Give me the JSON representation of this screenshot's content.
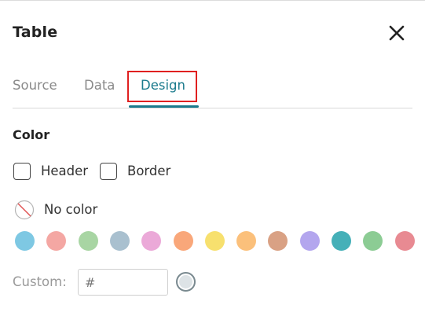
{
  "dialog": {
    "title": "Table"
  },
  "tabs": [
    {
      "label": "Source"
    },
    {
      "label": "Data"
    },
    {
      "label": "Design",
      "active": true
    }
  ],
  "color_section": {
    "title": "Color",
    "header_label": "Header",
    "border_label": "Border",
    "header_checked": false,
    "border_checked": false,
    "no_color_label": "No color"
  },
  "swatches": [
    "#7ec8e3",
    "#f4a7a3",
    "#a8d5a3",
    "#a9c0cf",
    "#eba9d8",
    "#f9a77a",
    "#f7e06e",
    "#fbc07b",
    "#d9a184",
    "#b3a6ee",
    "#45b0b8",
    "#8ccc94",
    "#e88a92"
  ],
  "custom": {
    "label": "Custom:",
    "placeholder": "#",
    "swatch_color": "#dde3e6"
  },
  "colors": {
    "accent": "#1a7a8c",
    "highlight": "#e02020"
  }
}
